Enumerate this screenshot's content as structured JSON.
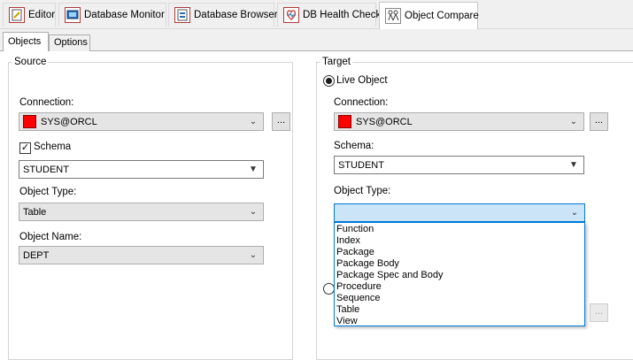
{
  "doc_tabs": [
    {
      "label": "Editor",
      "icon": "editor-icon"
    },
    {
      "label": "Database Monitor",
      "icon": "database-monitor-icon"
    },
    {
      "label": "Database Browser",
      "icon": "database-browser-icon"
    },
    {
      "label": "DB Health Check",
      "icon": "health-check-icon"
    },
    {
      "label": "Object Compare",
      "icon": "object-compare-icon"
    }
  ],
  "inner_tabs": [
    {
      "label": "Objects"
    },
    {
      "label": "Options"
    }
  ],
  "source": {
    "title": "Source",
    "connection_label": "Connection:",
    "connection_value": "SYS@ORCL",
    "dots": "...",
    "schema_label": "Schema",
    "schema_checked": true,
    "schema_value": "STUDENT",
    "object_type_label": "Object Type:",
    "object_type_value": "Table",
    "object_name_label": "Object Name:",
    "object_name_value": "DEPT"
  },
  "target": {
    "title": "Target",
    "live_object_label": "Live Object",
    "connection_label": "Connection:",
    "connection_value": "SYS@ORCL",
    "dots": "...",
    "schema_label": "Schema:",
    "schema_value": "STUDENT",
    "object_type_label": "Object Type:",
    "object_type_value": "",
    "object_type_options": [
      "Function",
      "Index",
      "Package",
      "Package Body",
      "Package Spec and Body",
      "Procedure",
      "Sequence",
      "Table",
      "View"
    ]
  },
  "colors": {
    "connection_swatch": "#ff0000",
    "focus_blue": "#0078d7",
    "focus_fill": "#cce4f7"
  }
}
